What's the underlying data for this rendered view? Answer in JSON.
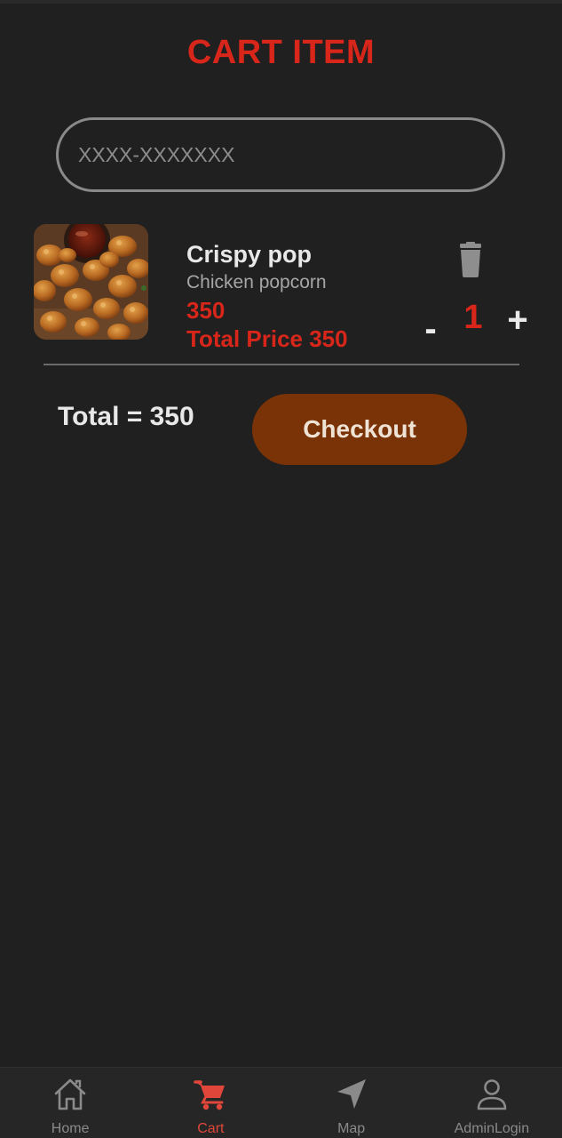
{
  "header": {
    "title": "CART ITEM"
  },
  "phone_field": {
    "placeholder": "XXXX-XXXXXXX",
    "value": ""
  },
  "cart_items": [
    {
      "name": "Crispy pop",
      "description": "Chicken popcorn",
      "price": "350",
      "total_price_label": "Total Price 350",
      "quantity": "1",
      "minus_label": "-",
      "plus_label": "+",
      "image_icon": "chicken-popcorn-photo",
      "delete_icon": "trash-icon"
    }
  ],
  "summary": {
    "total_label": "Total = 350",
    "checkout_label": "Checkout"
  },
  "bottom_nav": {
    "items": [
      {
        "label": "Home",
        "icon": "home-icon",
        "active": false
      },
      {
        "label": "Cart",
        "icon": "cart-icon",
        "active": true
      },
      {
        "label": "Map",
        "icon": "navigation-arrow-icon",
        "active": false
      },
      {
        "label": "AdminLogin",
        "icon": "user-icon",
        "active": false
      }
    ]
  },
  "colors": {
    "background": "#202020",
    "accent_red": "#d8261a",
    "checkout_brown": "#7a3306",
    "nav_background": "#262626",
    "nav_active": "#e0473a",
    "nav_inactive": "#8a8a8a"
  }
}
